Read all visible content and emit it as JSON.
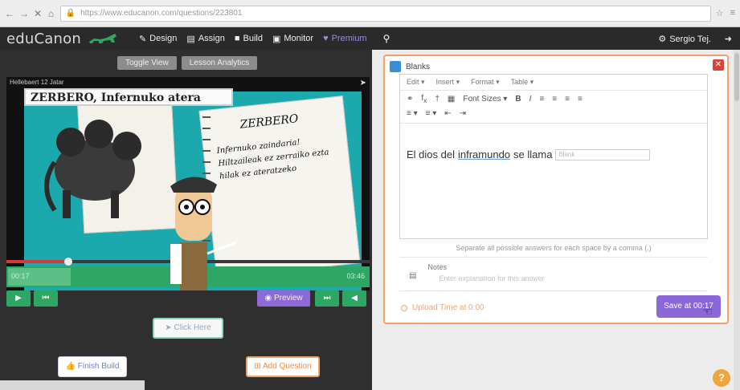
{
  "browser": {
    "url": "https://www.educanon.com/questions/223801",
    "icons": [
      "back-icon",
      "forward-icon",
      "close-icon",
      "home-icon",
      "lock-icon",
      "star-icon",
      "menu-icon"
    ]
  },
  "nav": {
    "logo": "eduCanon",
    "items": [
      {
        "label": "Design",
        "icon": "wrench-icon"
      },
      {
        "label": "Assign",
        "icon": "calendar-icon"
      },
      {
        "label": "Build",
        "icon": "book-icon"
      },
      {
        "label": "Monitor",
        "icon": "chart-icon"
      },
      {
        "label": "Premium",
        "icon": "heart-icon"
      }
    ],
    "user": "Sergio Tej."
  },
  "left": {
    "toggle_label": "Toggle View",
    "embed_label": "Lesson Analytics",
    "video_title": "Hellebaert 12 Jatar",
    "banner_text": "ZERBERO, Infernuko atera",
    "notebook_title": "ZERBERO",
    "notebook_body": "Infernuko zaindaria! Hiltzaileak ez zerraiko ezta hilak ez ateratzeko",
    "timeline_start": "00:17",
    "timeline_end": "03:46",
    "progress": 0.17,
    "preview_label": "Preview",
    "click_here": "Click Here",
    "finish_build": "Finish Build",
    "add_question": "Add Question"
  },
  "dialog": {
    "title": "Blanks",
    "menubar": [
      "Edit",
      "Insert",
      "Format",
      "Table"
    ],
    "font_sizes": "Font Sizes",
    "text_prefix": "El dios del",
    "text_underlined": "inframundo",
    "text_suffix": "se llama",
    "blank_placeholder": "Blank",
    "helper": "Separate all possible answers for each space by a comma (,)",
    "notes_label": "Notes",
    "notes_placeholder": "Enter explanation for this answer",
    "upload_label": "Upload Time at 0:00",
    "save_label": "Save at 00:17"
  }
}
